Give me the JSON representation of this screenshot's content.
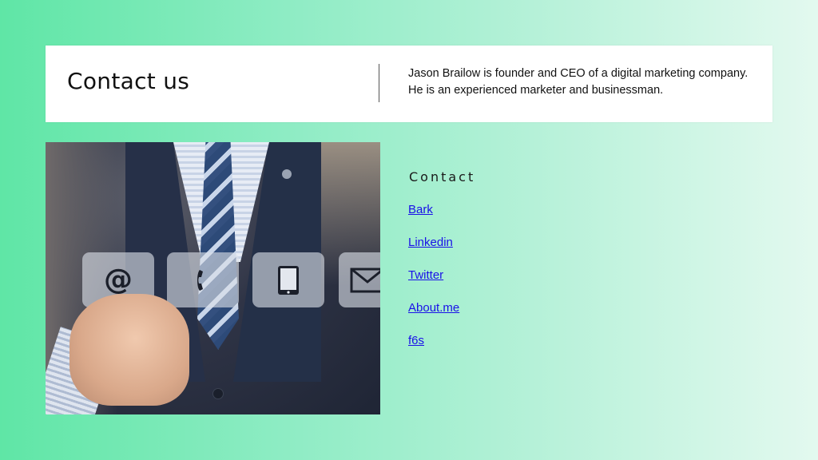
{
  "header": {
    "title": "Contact us",
    "bio_lines": [
      "Jason Brailow is founder and CEO of a digital marketing company.",
      "He is an experienced marketer and businessman."
    ]
  },
  "photo": {
    "tiles": [
      {
        "icon": "at-icon",
        "glyph": "@"
      },
      {
        "icon": "phone-icon"
      },
      {
        "icon": "tablet-icon"
      },
      {
        "icon": "mail-icon"
      }
    ]
  },
  "contact": {
    "heading": "Contact",
    "links": [
      "Bark",
      "Linkedin",
      "Twitter",
      "About.me",
      "f6s"
    ]
  },
  "colors": {
    "link": "#1a10e8",
    "gradient_start": "#5fe6a6",
    "gradient_end": "#e3f9ef"
  }
}
